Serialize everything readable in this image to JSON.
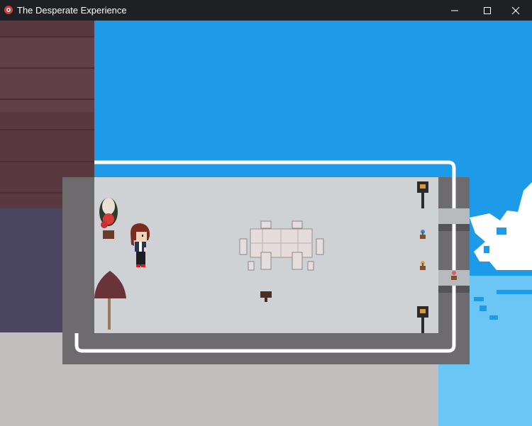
{
  "window": {
    "title": "The Desperate Experience",
    "app_icon": "game-app-icon",
    "controls": [
      "minimize-icon",
      "maximize-icon",
      "close-icon"
    ]
  },
  "colors": {
    "sky": "#1e9be8",
    "sky_reflection": "#6cc6f5",
    "terrace_floor": "#cfd2d4",
    "terrace_rim": "#6d6b6d",
    "railing": "#ffffff",
    "building_wall": "#5a3840",
    "building_base": "#4a4560",
    "ground": "#c2bebd",
    "cloud": "#ffffff"
  }
}
